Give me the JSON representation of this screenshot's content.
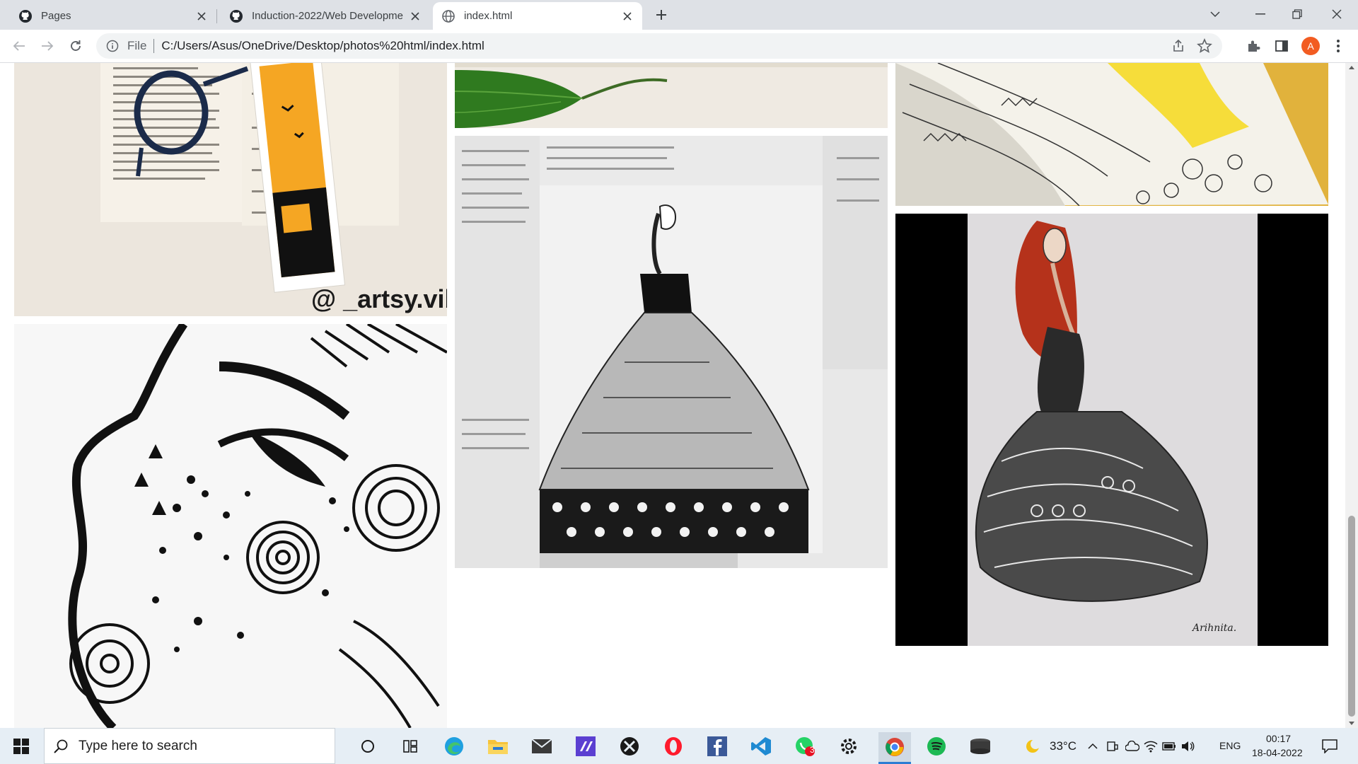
{
  "browser": {
    "tabs": [
      {
        "title": "Pages",
        "icon": "github-icon",
        "active": false
      },
      {
        "title": "Induction-2022/Web Developme",
        "icon": "github-icon",
        "active": false
      },
      {
        "title": "index.html",
        "icon": "globe-icon",
        "active": true
      }
    ],
    "address": {
      "scheme_label": "File",
      "url": "C:/Users/Asus/OneDrive/Desktop/photos%20html/index.html"
    },
    "profile_initial": "A",
    "accent": "#f25c22"
  },
  "gallery": {
    "watermark": "@ _artsy.vibe",
    "signature_1": "Arihnita.",
    "signature_2": "Arihnita."
  },
  "taskbar": {
    "search_placeholder": "Type here to search",
    "weather": "33°C",
    "language": "ENG",
    "time": "00:17",
    "date": "18-04-2022",
    "whatsapp_badge": "3"
  }
}
